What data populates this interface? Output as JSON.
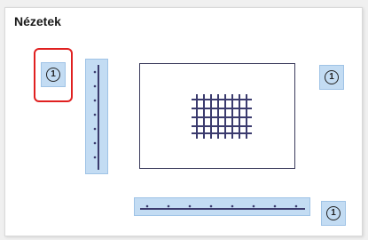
{
  "panel": {
    "title": "Nézetek"
  },
  "views": {
    "top_left": {
      "label": "1",
      "icon": "view-number-icon",
      "selected": true
    },
    "top_right": {
      "label": "1",
      "icon": "view-number-icon"
    },
    "bottom_right": {
      "label": "1",
      "icon": "view-number-icon"
    }
  },
  "colors": {
    "accent_fill": "#c3dcf3",
    "accent_border": "#9fc3e6",
    "selection": "#e02020",
    "grid_lines": "#3b3b6e"
  }
}
